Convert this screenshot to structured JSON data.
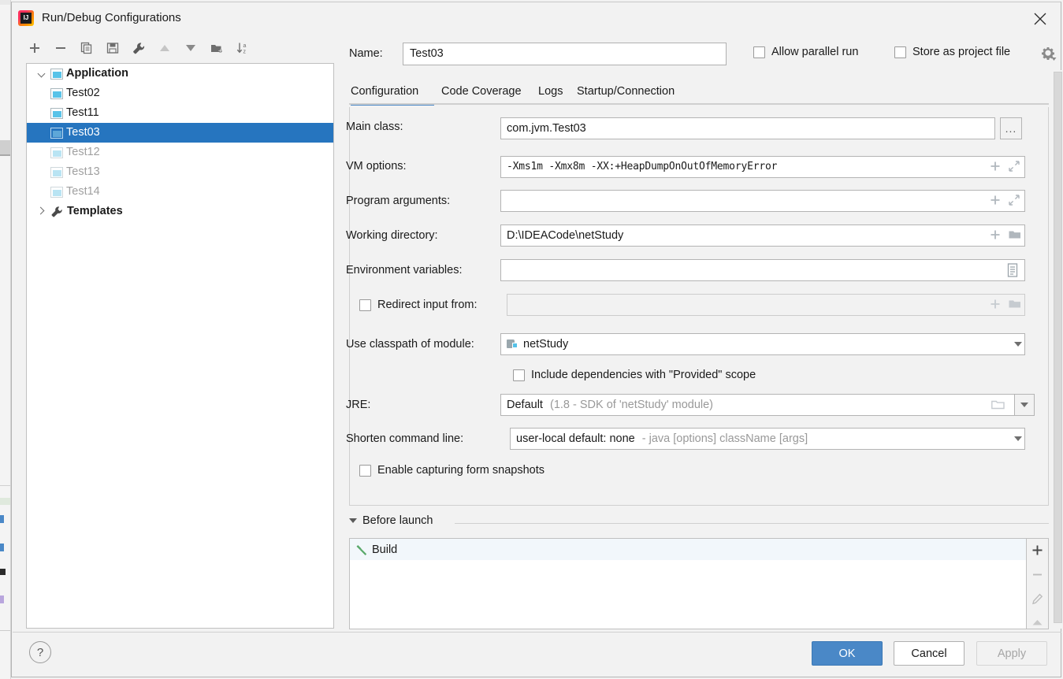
{
  "window": {
    "title": "Run/Debug Configurations",
    "app_icon": "intellij-idea-icon",
    "close_icon": "close-icon"
  },
  "tree_toolbar": {
    "buttons": [
      {
        "name": "add-configuration-button",
        "icon": "plus-icon",
        "tooltip": "Add New Configuration"
      },
      {
        "name": "remove-configuration-button",
        "icon": "minus-icon",
        "tooltip": "Remove Configuration"
      },
      {
        "name": "copy-configuration-button",
        "icon": "copy-icon",
        "tooltip": "Copy Configuration"
      },
      {
        "name": "save-configuration-button",
        "icon": "save-icon",
        "tooltip": "Save Configuration"
      },
      {
        "name": "edit-templates-button",
        "icon": "wrench-icon",
        "tooltip": "Edit Templates"
      },
      {
        "name": "move-up-button",
        "icon": "arrow-up-icon",
        "tooltip": "Move Up"
      },
      {
        "name": "move-down-button",
        "icon": "arrow-down-icon",
        "tooltip": "Move Down"
      },
      {
        "name": "new-folder-button",
        "icon": "folder-add-icon",
        "tooltip": "Create New Folder"
      },
      {
        "name": "sort-button",
        "icon": "sort-alphabetically-icon",
        "tooltip": "Sort Configurations"
      }
    ]
  },
  "tree": {
    "groups": [
      {
        "label": "Application",
        "icon": "application-icon",
        "expanded": true,
        "children": [
          {
            "label": "Test02",
            "icon": "application-icon",
            "selected": false,
            "dim": false
          },
          {
            "label": "Test11",
            "icon": "application-icon",
            "selected": false,
            "dim": false
          },
          {
            "label": "Test03",
            "icon": "application-icon",
            "selected": true,
            "dim": false
          },
          {
            "label": "Test12",
            "icon": "application-icon",
            "selected": false,
            "dim": true
          },
          {
            "label": "Test13",
            "icon": "application-icon",
            "selected": false,
            "dim": true
          },
          {
            "label": "Test14",
            "icon": "application-icon",
            "selected": false,
            "dim": true
          }
        ]
      },
      {
        "label": "Templates",
        "icon": "wrench-icon",
        "expanded": false,
        "children": []
      }
    ]
  },
  "header": {
    "name_label": "Name:",
    "name_value": "Test03",
    "allow_parallel_run": {
      "label": "Allow parallel run",
      "checked": false
    },
    "store_as_project_file": {
      "label": "Store as project file",
      "checked": false
    },
    "settings_icon": "gear-icon"
  },
  "tabs": {
    "items": [
      {
        "label": "Configuration",
        "active": true
      },
      {
        "label": "Code Coverage",
        "active": false
      },
      {
        "label": "Logs",
        "active": false
      },
      {
        "label": "Startup/Connection",
        "active": false
      }
    ],
    "active_color": "#4a88c7"
  },
  "configuration": {
    "main_class": {
      "label": "Main class:",
      "value": "com.jvm.Test03",
      "browse_label": "...",
      "browse_icon": "ellipsis-icon"
    },
    "vm_options": {
      "label": "VM options:",
      "value": "-Xms1m -Xmx8m -XX:+HeapDumpOnOutOfMemoryError",
      "icons": [
        "plus-icon",
        "expand-icon"
      ]
    },
    "program_arguments": {
      "label": "Program arguments:",
      "value": "",
      "icons": [
        "plus-icon",
        "expand-icon"
      ]
    },
    "working_directory": {
      "label": "Working directory:",
      "value": "D:\\IDEACode\\netStudy",
      "icons": [
        "plus-icon",
        "folder-icon"
      ]
    },
    "environment_variables": {
      "label": "Environment variables:",
      "value": "",
      "icons": [
        "list-edit-icon"
      ]
    },
    "redirect_input_from": {
      "label": "Redirect input from:",
      "checked": false,
      "value": "",
      "disabled": true,
      "icons": [
        "plus-icon",
        "folder-icon"
      ]
    },
    "use_classpath_of_module": {
      "label": "Use classpath of module:",
      "value": "netStudy",
      "value_icon": "module-icon",
      "dropdown_icon": "chevron-down-icon"
    },
    "include_provided_scope": {
      "label": "Include dependencies with \"Provided\" scope",
      "checked": false
    },
    "jre": {
      "label": "JRE:",
      "value": "Default",
      "value_hint": "(1.8 - SDK of 'netStudy' module)",
      "icons": [
        "folder-icon",
        "chevron-down-icon"
      ]
    },
    "shorten_command_line": {
      "label": "Shorten command line:",
      "value": "user-local default: none",
      "value_hint": "- java [options] className [args]",
      "dropdown_icon": "chevron-down-icon"
    },
    "enable_form_snapshots": {
      "label": "Enable capturing form snapshots",
      "checked": false
    }
  },
  "before_launch": {
    "title": "Before launch",
    "expanded": true,
    "collapse_icon": "triangle-down-icon",
    "items": [
      {
        "label": "Build",
        "icon": "build-hammer-icon"
      }
    ],
    "side_buttons": [
      {
        "name": "add-task-button",
        "icon": "plus-icon"
      },
      {
        "name": "remove-task-button",
        "icon": "minus-icon",
        "disabled": true
      },
      {
        "name": "edit-task-button",
        "icon": "pencil-icon",
        "disabled": true
      },
      {
        "name": "move-task-up-button",
        "icon": "arrow-up-icon",
        "disabled": true
      }
    ]
  },
  "footer": {
    "help_label": "?",
    "help_icon": "help-icon",
    "ok_label": "OK",
    "cancel_label": "Cancel",
    "apply_label": "Apply",
    "apply_disabled": true,
    "primary_color": "#4a88c7"
  },
  "scrollbar": {
    "name": "vertical-scrollbar",
    "thumb_color": "#d8d8d8"
  }
}
